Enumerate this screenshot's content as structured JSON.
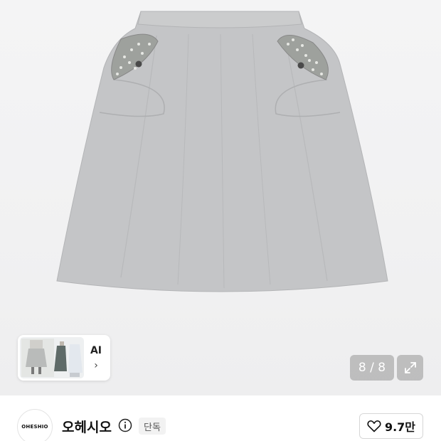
{
  "product": {
    "image_description_icon": "skirt-product-image",
    "page_counter": "8 / 8"
  },
  "ai_card": {
    "label": "AI",
    "chevron": "›"
  },
  "store": {
    "logo_text": "OHESHIO",
    "name": "오헤시오",
    "badge": "단독"
  },
  "like": {
    "count": "9.7만"
  },
  "icons": {
    "expand": "expand-icon",
    "info": "info-icon",
    "heart": "heart-icon",
    "chevron": "chevron-right-icon"
  },
  "colors": {
    "skirt": "#c4c5c7",
    "counter_bg": "#9a9a9a"
  }
}
